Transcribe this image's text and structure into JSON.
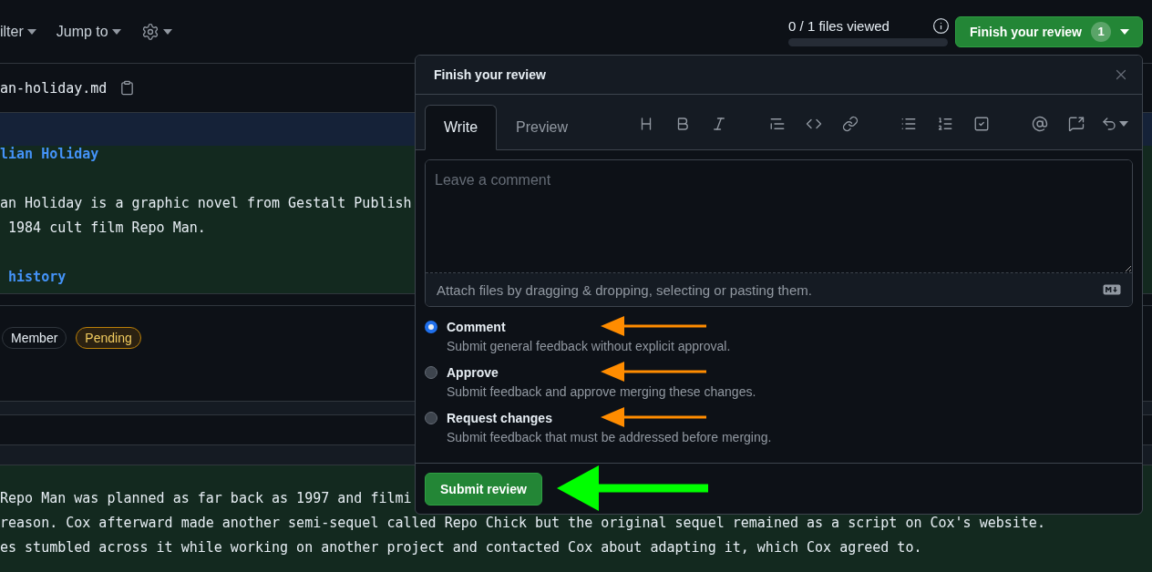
{
  "topbar": {
    "filter_label": "ilter",
    "jump_label": "Jump to",
    "files_viewed": "0 / 1 files viewed",
    "progress": {
      "level": 0
    },
    "finish_button": {
      "label": "Finish your review",
      "count": "1"
    }
  },
  "file": {
    "name": "an-holiday.md"
  },
  "diff_top": [
    {
      "kind": "heading",
      "text": "lian Holiday"
    },
    {
      "kind": "blank"
    },
    {
      "kind": "text",
      "text": "an Holiday is a graphic novel from Gestalt Publish"
    },
    {
      "kind": "text",
      "text": " 1984 cult film Repo Man."
    },
    {
      "kind": "blank"
    },
    {
      "kind": "heading",
      "text": " history"
    }
  ],
  "comment": {
    "badges": [
      {
        "kind": "role",
        "label": "Member"
      },
      {
        "kind": "pending",
        "label": "Pending"
      }
    ]
  },
  "diff_bottom": [
    {
      "kind": "blank"
    },
    {
      "kind": "text",
      "text": "Repo Man was planned as far back as 1997 and filmi"
    },
    {
      "kind": "text",
      "text": "reason. Cox afterward made another semi-sequel called Repo Chick but the original sequel remained as a script on Cox's website."
    },
    {
      "kind": "text",
      "text": "es stumbled across it while working on another project and contacted Cox about adapting it, which Cox agreed to."
    }
  ],
  "popup": {
    "title": "Finish your review",
    "tabs": [
      {
        "label": "Write",
        "selected": true
      },
      {
        "label": "Preview",
        "selected": false
      }
    ],
    "placeholder": "Leave a comment",
    "attach_text": "Attach files by dragging & dropping, selecting or pasting them.",
    "options": [
      {
        "label": "Comment",
        "description": "Submit general feedback without explicit approval.",
        "selected": true
      },
      {
        "label": "Approve",
        "description": "Submit feedback and approve merging these changes.",
        "selected": false
      },
      {
        "label": "Request changes",
        "description": "Submit feedback that must be addressed before merging.",
        "selected": false
      }
    ],
    "submit": "Submit review"
  }
}
